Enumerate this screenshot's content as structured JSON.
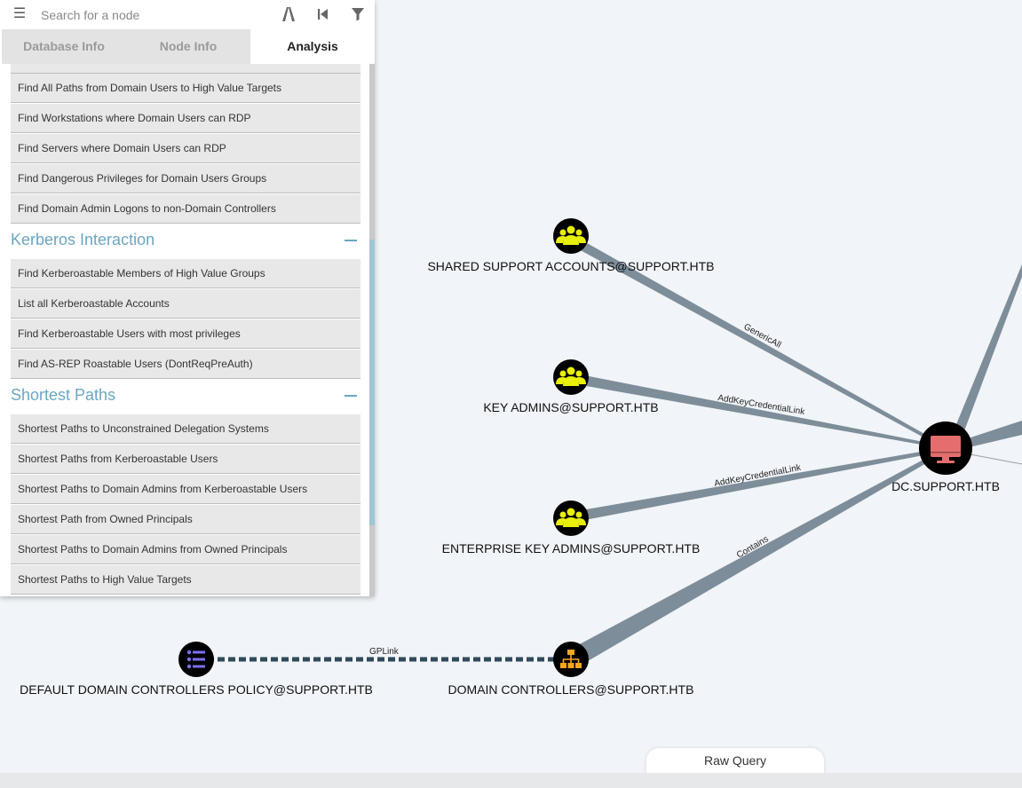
{
  "search": {
    "placeholder": "Search for a node"
  },
  "tabs": [
    {
      "label": "Database Info",
      "active": false
    },
    {
      "label": "Node Info",
      "active": false
    },
    {
      "label": "Analysis",
      "active": true
    }
  ],
  "queries": {
    "top_items": [
      "Find All Paths from Domain Users to High Value Targets",
      "Find Workstations where Domain Users can RDP",
      "Find Servers where Domain Users can RDP",
      "Find Dangerous Privileges for Domain Users Groups",
      "Find Domain Admin Logons to non-Domain Controllers"
    ],
    "kerberos": {
      "title": "Kerberos Interaction",
      "items": [
        "Find Kerberoastable Members of High Value Groups",
        "List all Kerberoastable Accounts",
        "Find Kerberoastable Users with most privileges",
        "Find AS-REP Roastable Users (DontReqPreAuth)"
      ]
    },
    "shortest": {
      "title": "Shortest Paths",
      "items": [
        "Shortest Paths to Unconstrained Delegation Systems",
        "Shortest Paths from Kerberoastable Users",
        "Shortest Paths to Domain Admins from Kerberoastable Users",
        "Shortest Path from Owned Principals",
        "Shortest Paths to Domain Admins from Owned Principals",
        "Shortest Paths to High Value Targets"
      ]
    }
  },
  "graph": {
    "nodes": {
      "shared_support": "SHARED SUPPORT ACCOUNTS@SUPPORT.HTB",
      "key_admins": "KEY ADMINS@SUPPORT.HTB",
      "enterprise_key_admins": "ENTERPRISE KEY ADMINS@SUPPORT.HTB",
      "domain_controllers": "DOMAIN CONTROLLERS@SUPPORT.HTB",
      "gpo": "DEFAULT DOMAIN CONTROLLERS POLICY@SUPPORT.HTB",
      "dc": "DC.SUPPORT.HTB"
    },
    "edges": {
      "generic_all": "GenericAll",
      "add_key_1": "AddKeyCredentialLink",
      "add_key_2": "AddKeyCredentialLink",
      "contains": "Contains",
      "gplink": "GPLink"
    },
    "colors": {
      "group": "#e8ef0a",
      "computer": "#e46e6e",
      "ou": "#f5a623",
      "gpo": "#7c6ff5",
      "edge": "#7d8d99"
    },
    "icons": {
      "group": "users-icon",
      "computer": "monitor-icon",
      "ou": "sitemap-icon",
      "gpo": "list-icon"
    }
  },
  "footer": {
    "raw_query": "Raw Query"
  }
}
